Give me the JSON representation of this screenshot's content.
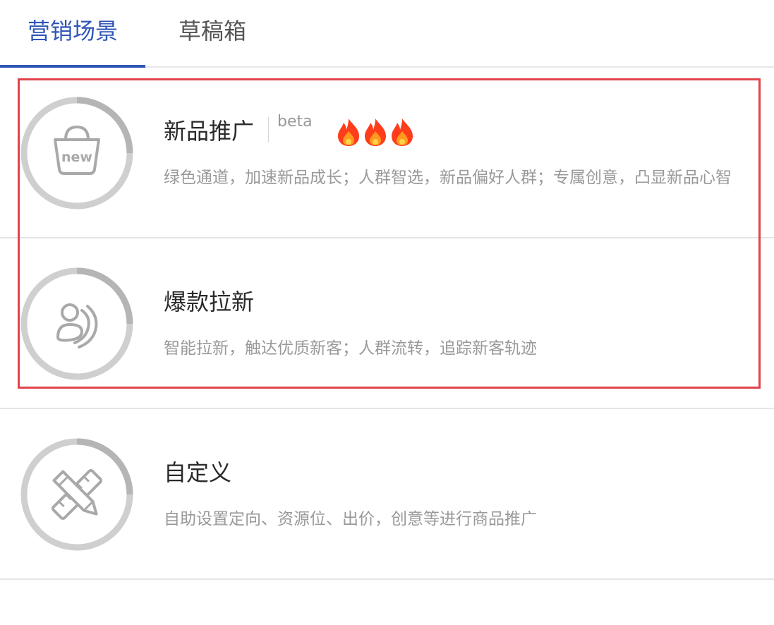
{
  "tabs": [
    {
      "label": "营销场景",
      "active": true
    },
    {
      "label": "草稿箱",
      "active": false
    }
  ],
  "scenes": [
    {
      "title": "新品推广",
      "badge": "beta",
      "flames": 3,
      "description": "绿色通道，加速新品成长；人群智选，新品偏好人群；专属创意，凸显新品心智",
      "icon": "new-bag-icon"
    },
    {
      "title": "爆款拉新",
      "description": "智能拉新，触达优质新客；人群流转，追踪新客轨迹",
      "icon": "user-wave-icon"
    },
    {
      "title": "自定义",
      "description": "自助设置定向、资源位、出价，创意等进行商品推广",
      "icon": "pencil-ruler-icon"
    }
  ],
  "colors": {
    "accent": "#2f55b6",
    "highlight_border": "#e2434b",
    "text_primary": "#2a2a2a",
    "text_secondary": "#999999",
    "ring": "#c8c8c8",
    "flame": "#ff4d1f"
  }
}
